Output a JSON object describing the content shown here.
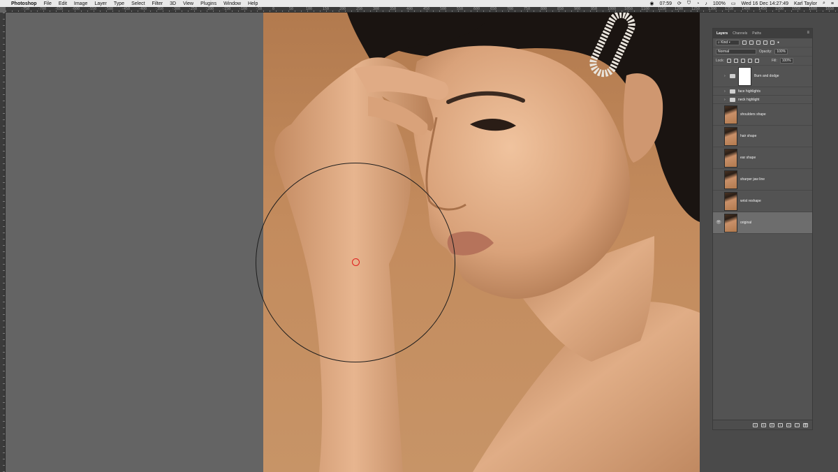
{
  "menubar": {
    "app": "Photoshop",
    "items": [
      "File",
      "Edit",
      "Image",
      "Layer",
      "Type",
      "Select",
      "Filter",
      "3D",
      "View",
      "Plugins",
      "Window",
      "Help"
    ],
    "clock_small": "07:59",
    "battery": "100%",
    "datetime": "Wed 16 Dec  14:27:49",
    "user": "Karl Taylor"
  },
  "ruler_top": {
    "labels": [
      "-750",
      "-700",
      "-650",
      "-600",
      "-550",
      "-500",
      "-450",
      "-400",
      "-350",
      "-300",
      "-250",
      "-200",
      "-150",
      "-100",
      "-50",
      "0",
      "50",
      "100",
      "150",
      "200",
      "250",
      "300",
      "350",
      "400",
      "450",
      "500",
      "550",
      "600",
      "650",
      "700",
      "750",
      "800",
      "850",
      "900",
      "950",
      "1000",
      "1050",
      "1100",
      "1150",
      "1200",
      "1250",
      "1300",
      "1350",
      "1400",
      "1450",
      "1500",
      "1550",
      "1600",
      "1650",
      "1700"
    ]
  },
  "layers_panel": {
    "tabs": [
      {
        "label": "Layers",
        "active": true
      },
      {
        "label": "Channels",
        "active": false
      },
      {
        "label": "Paths",
        "active": false
      }
    ],
    "filter_kind": "Kind",
    "blend_mode": "Normal",
    "opacity_label": "Opacity:",
    "opacity_value": "100%",
    "lock_label": "Lock:",
    "fill_label": "Fill:",
    "fill_value": "100%",
    "layers": [
      {
        "name": "Burn and dodge",
        "type": "group-mask",
        "visible": false,
        "selected": false
      },
      {
        "name": "face highlights",
        "type": "group",
        "visible": false,
        "selected": false
      },
      {
        "name": "neck highlight",
        "type": "group",
        "visible": false,
        "selected": false
      },
      {
        "name": "shoulders shape",
        "type": "pixel",
        "visible": false,
        "selected": false
      },
      {
        "name": "hair shape",
        "type": "pixel",
        "visible": false,
        "selected": false
      },
      {
        "name": "ear shape",
        "type": "pixel",
        "visible": false,
        "selected": false
      },
      {
        "name": "sharper jaw line",
        "type": "pixel",
        "visible": false,
        "selected": false
      },
      {
        "name": "wrist reshape",
        "type": "pixel",
        "visible": false,
        "selected": false
      },
      {
        "name": "original",
        "type": "pixel",
        "visible": true,
        "selected": true
      }
    ]
  },
  "colors": {
    "workspace": "#646464",
    "panel": "#535353",
    "backdrop": "#c38b5d",
    "skin": "#d9a27a",
    "hair": "#1a1411",
    "brush_center": "#e01b1b"
  }
}
